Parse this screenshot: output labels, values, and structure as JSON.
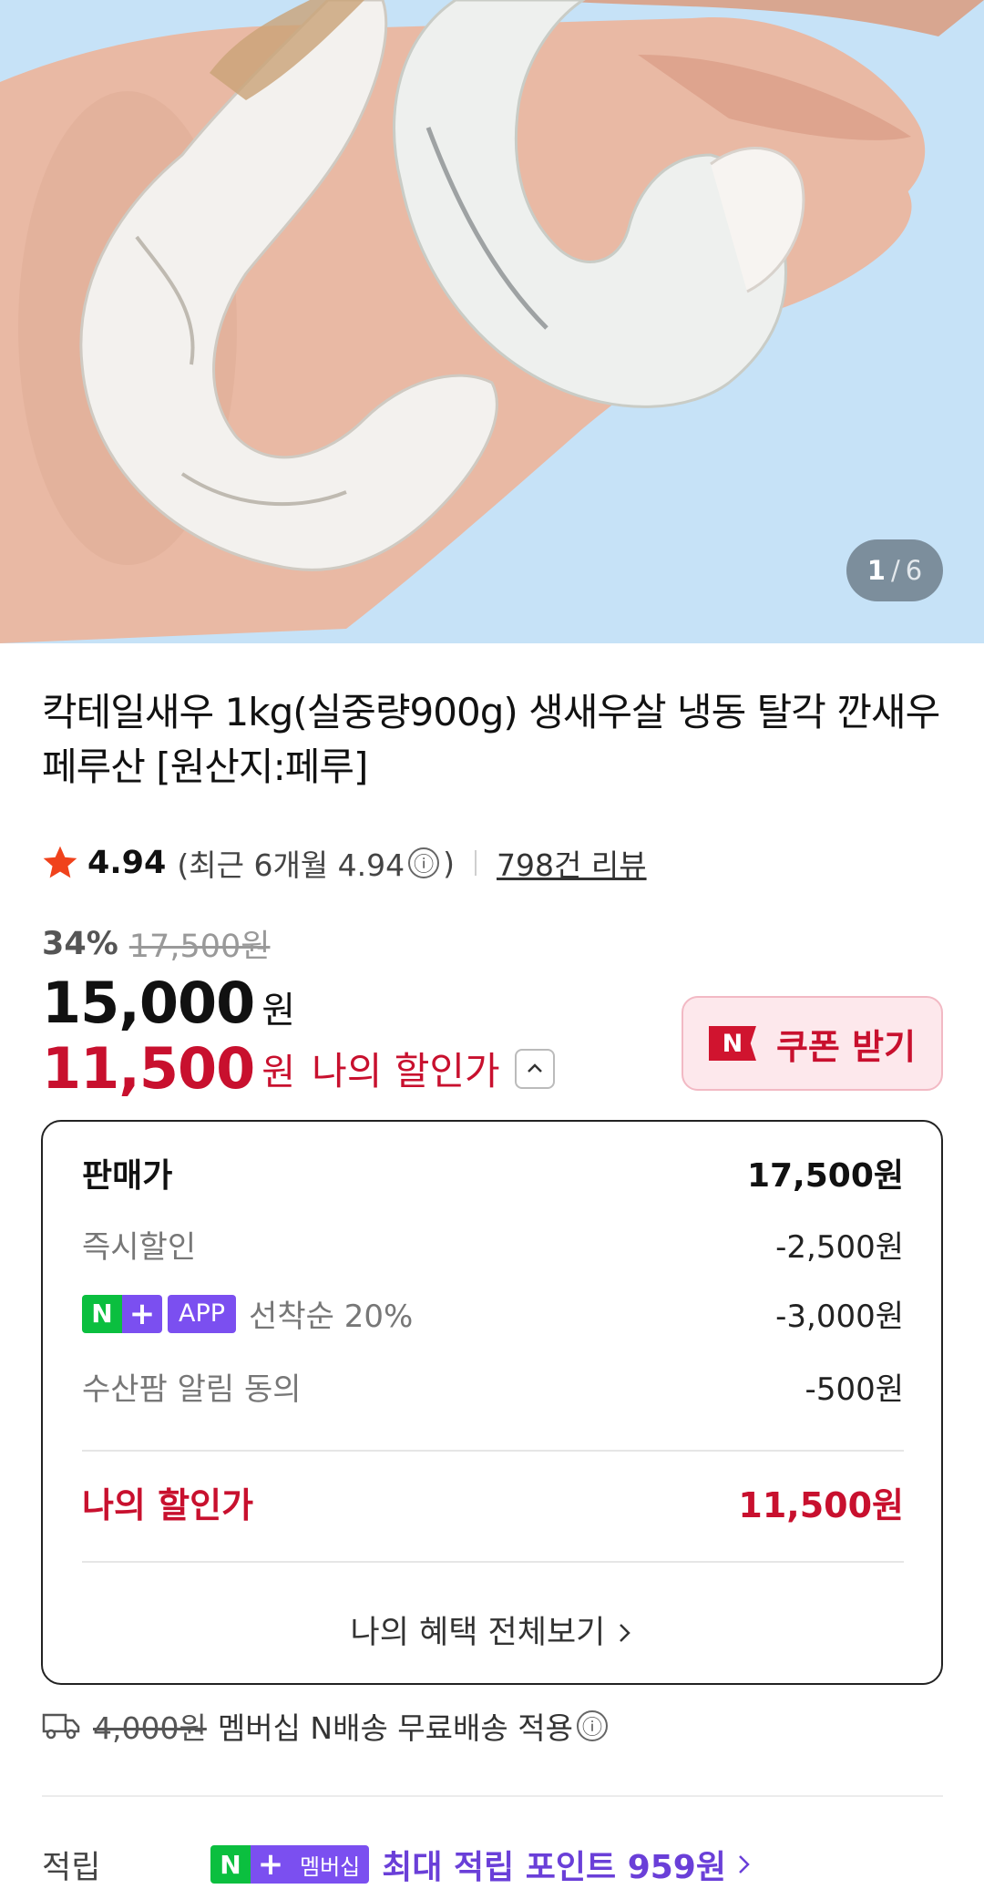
{
  "gallery": {
    "current": "1",
    "separator": "/",
    "total": "6"
  },
  "product": {
    "title": "칵테일새우 1kg(실중량900g) 생새우살 냉동 탈각 깐새우 페루산 [원산지:페루]"
  },
  "rating": {
    "value": "4.94",
    "recent_prefix": "(최근 6개월 4.94",
    "recent_suffix": ")",
    "info_icon": "ⓘ",
    "review_count": "798건 리뷰"
  },
  "price": {
    "discount_rate": "34%",
    "original": "17,500원",
    "sale_value": "15,000",
    "sale_unit": "원",
    "my_value": "11,500",
    "my_unit": "원",
    "my_label": "나의 할인가"
  },
  "coupon": {
    "badge": "N",
    "label": "쿠폰 받기"
  },
  "breakdown": {
    "sale_label": "판매가",
    "sale_value": "17,500원",
    "instant_label": "즉시할인",
    "instant_value": "-2,500원",
    "tag_n": "N",
    "tag_plus": "+",
    "tag_app": "APP",
    "app_label": "선착순 20%",
    "app_value": "-3,000원",
    "alarm_label": "수산팜 알림 동의",
    "alarm_value": "-500원",
    "total_label": "나의 할인가",
    "total_value": "11,500원",
    "view_all": "나의 혜택 전체보기"
  },
  "shipping": {
    "old_fee": "4,000원",
    "text": "멤버십 N배송 무료배송 적용"
  },
  "points": {
    "label": "적립",
    "tag_n": "N",
    "tag_plus": "+",
    "tag_member": "멤버십",
    "text": "최대 적립 포인트 959원"
  },
  "colors": {
    "accent_red": "#c8102e",
    "naver_green": "#0bbf3f",
    "membership_purple": "#7b4ff0",
    "hero_bg": "#c6e2f7"
  },
  "icons": [
    "star-icon",
    "info-icon",
    "chevron-up-icon",
    "chevron-right-icon",
    "truck-icon"
  ]
}
